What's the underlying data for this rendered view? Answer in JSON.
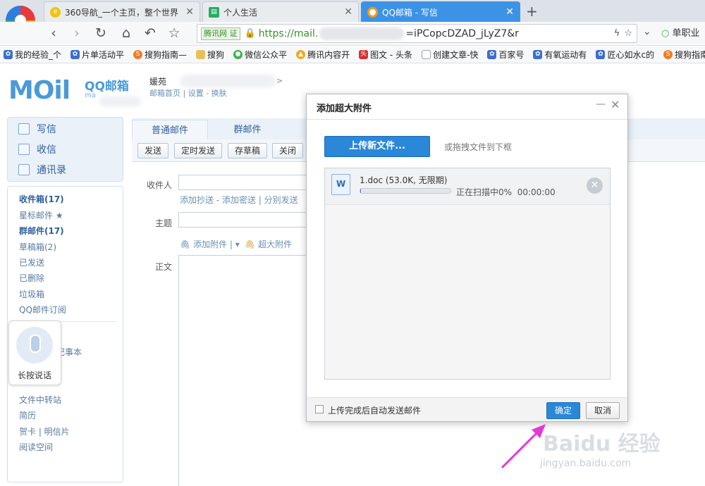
{
  "browser": {
    "tabs": [
      {
        "title": "360导航_一个主页，整个世界",
        "icon": "360-nav-icon",
        "color": "#f1c40f"
      },
      {
        "title": "个人生活",
        "icon": "sheet-icon",
        "color": "#27ae60"
      },
      {
        "title": "QQ邮箱 - 写信",
        "icon": "qqmail-icon",
        "color": "#f39c12"
      }
    ],
    "url_badge": "腾讯网",
    "url_badge2": "证",
    "url_scheme": "https://mail.",
    "url_tail": "=iPCopcDZAD_jLyZ7&r",
    "search_label": "单职业",
    "bookmarks": [
      {
        "label": "我的经验_个",
        "icon": "paw-icon",
        "color": "#3c6ecf"
      },
      {
        "label": "片单活动平",
        "icon": "paw-icon",
        "color": "#3c6ecf"
      },
      {
        "label": "搜狗指南—",
        "icon": "sogou-icon",
        "color": "#f07c2a"
      },
      {
        "label": "搜狗",
        "icon": "folder-icon",
        "color": "#e6c15a"
      },
      {
        "label": "微信公众平",
        "icon": "wechat-icon",
        "color": "#3bb34a"
      },
      {
        "label": "腾讯内容开",
        "icon": "bell-icon",
        "color": "#f2a81d"
      },
      {
        "label": "图文 - 头条",
        "icon": "toutiao-icon",
        "color": "#d8302f"
      },
      {
        "label": "创建文章-快",
        "icon": "page-icon",
        "color": "#9aa4b0"
      },
      {
        "label": "百家号",
        "icon": "paw-icon",
        "color": "#3c6ecf"
      },
      {
        "label": "有氧运动有",
        "icon": "paw-icon",
        "color": "#3c6ecf"
      },
      {
        "label": "匠心如水c的",
        "icon": "paw-icon",
        "color": "#3c6ecf"
      },
      {
        "label": "搜狗指南",
        "icon": "sogou-icon",
        "color": "#f07c2a"
      }
    ]
  },
  "mail": {
    "logo_text": "MOil",
    "logo_cn": "QQ邮箱",
    "logo_sub": "ma",
    "user_name": "媛苑",
    "user_links": "邮箱首页 | 设置 - 换肤",
    "nav": {
      "write": "写信",
      "inbox": "收信",
      "contacts": "通讯录"
    },
    "folders": [
      {
        "label": "收件箱(17)",
        "bold": true
      },
      {
        "label": "星标邮件 ★",
        "bold": false
      },
      {
        "label": "群邮件(17)",
        "bold": true
      },
      {
        "label": "草稿箱(2)",
        "bold": false
      },
      {
        "label": "已发送",
        "bold": false
      },
      {
        "label": "已删除",
        "bold": false
      },
      {
        "label": "垃圾箱",
        "bold": false
      },
      {
        "label": "QQ邮件订阅",
        "bold": false
      }
    ],
    "more_items": [
      "记事本",
      "文件中转站",
      "简历",
      "贺卡 | 明信片",
      "阅读空间"
    ],
    "voice_label": "长按说话",
    "compose_tabs": [
      "普通邮件",
      "群邮件"
    ],
    "toolbar": [
      "发送",
      "定时发送",
      "存草稿",
      "关闭"
    ],
    "fields": {
      "to_label": "收件人",
      "to_links": "添加抄送 - 添加密送 | 分别发送",
      "subject_label": "主题",
      "attach_label": "添加附件",
      "big_attach_label": "超大附件",
      "body_label": "正文"
    }
  },
  "dialog": {
    "title": "添加超大附件",
    "upload_button": "上传新文件...",
    "drag_hint": "或拖拽文件到下框",
    "file": {
      "name": "1.doc (53.0K, 无限期)",
      "status": "正在扫描中0%",
      "time": "00:00:00",
      "progress": 0
    },
    "auto_send_label": "上传完成后自动发送邮件",
    "ok_button": "确定",
    "cancel_button": "取消"
  },
  "watermark": {
    "text": "Baidu 经验",
    "sub": "jingyan.baidu.com"
  }
}
